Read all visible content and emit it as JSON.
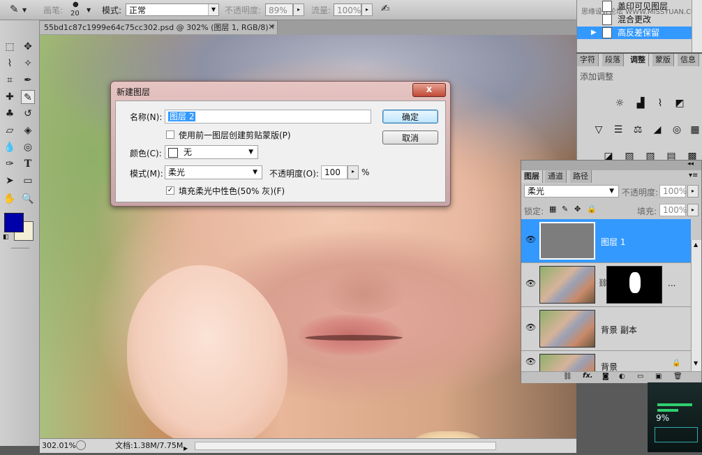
{
  "options_bar": {
    "brush_label": "画笔:",
    "brush_size": "20",
    "mode_label": "模式:",
    "mode_value": "正常",
    "opacity_label": "不透明度:",
    "opacity_value": "89%",
    "flow_label": "流量:",
    "flow_value": "100%"
  },
  "document_tab": {
    "title": "55bd1c87c1999e64c75cc302.psd @ 302% (图层 1, RGB/8) *",
    "close": "×"
  },
  "status_bar": {
    "zoom": "302.01%",
    "doc_info": "文档:1.38M/7.75M"
  },
  "dialog": {
    "title": "新建图层",
    "close": "x",
    "name_label": "名称(N):",
    "name_value": "图层 2",
    "clip_checkbox_label": "使用前一图层创建剪贴蒙版(P)",
    "color_label": "颜色(C):",
    "color_value": "无",
    "mode_label": "模式(M):",
    "mode_value": "柔光",
    "opacity_label": "不透明度(O):",
    "opacity_value": "100",
    "opacity_unit": "%",
    "fill_checkbox_label": "填充柔光中性色(50% 灰)(F)",
    "fill_checked": "✓",
    "ok_label": "确定",
    "cancel_label": "取消"
  },
  "history_panel": {
    "watermark": "思缘设计论坛 WWW.MISSYUAN.COM",
    "items": [
      "盖印可见图层",
      "混合更改",
      "高反差保留"
    ]
  },
  "adjust_panel": {
    "tabs": [
      "字符",
      "段落",
      "调整",
      "蒙版",
      "信息"
    ],
    "hint": "添加调整"
  },
  "layers_panel": {
    "tabs": [
      "图层",
      "通道",
      "路径"
    ],
    "blend_mode": "柔光",
    "opacity_label": "不透明度:",
    "opacity_value": "100%",
    "lock_label": "锁定:",
    "fill_label": "填充:",
    "fill_value": "100%",
    "layers": [
      {
        "name": "图层 1"
      },
      {
        "name": "..."
      },
      {
        "name": "背景 副本"
      },
      {
        "name": "背景"
      }
    ],
    "fx_label": "fx."
  },
  "widget": {
    "percent": "9%"
  },
  "colors": {
    "foreground": "#0000aa",
    "background": "#f2efd6",
    "selection": "#3399ff"
  }
}
